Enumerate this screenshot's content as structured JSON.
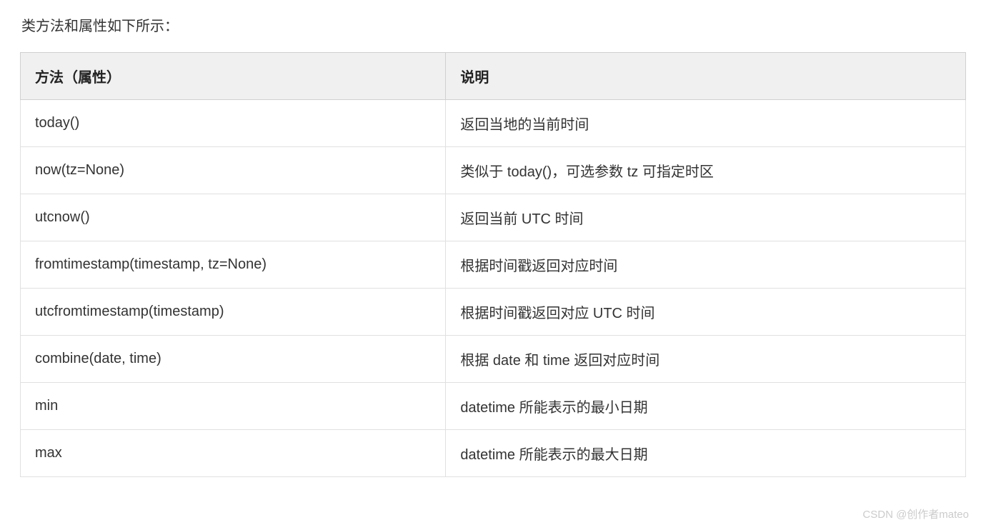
{
  "intro": "类方法和属性如下所示：",
  "table": {
    "headers": {
      "method": "方法（属性）",
      "description": "说明"
    },
    "rows": [
      {
        "method": "today()",
        "description": "返回当地的当前时间"
      },
      {
        "method": "now(tz=None)",
        "description": "类似于 today()，可选参数 tz 可指定时区"
      },
      {
        "method": "utcnow()",
        "description": "返回当前 UTC 时间"
      },
      {
        "method": "fromtimestamp(timestamp, tz=None)",
        "description": "根据时间戳返回对应时间"
      },
      {
        "method": "utcfromtimestamp(timestamp)",
        "description": "根据时间戳返回对应 UTC 时间"
      },
      {
        "method": "combine(date, time)",
        "description": "根据 date 和 time 返回对应时间"
      },
      {
        "method": "min",
        "description": "datetime 所能表示的最小日期"
      },
      {
        "method": "max",
        "description": "datetime 所能表示的最大日期"
      }
    ]
  },
  "watermark": "CSDN @创作者mateo"
}
